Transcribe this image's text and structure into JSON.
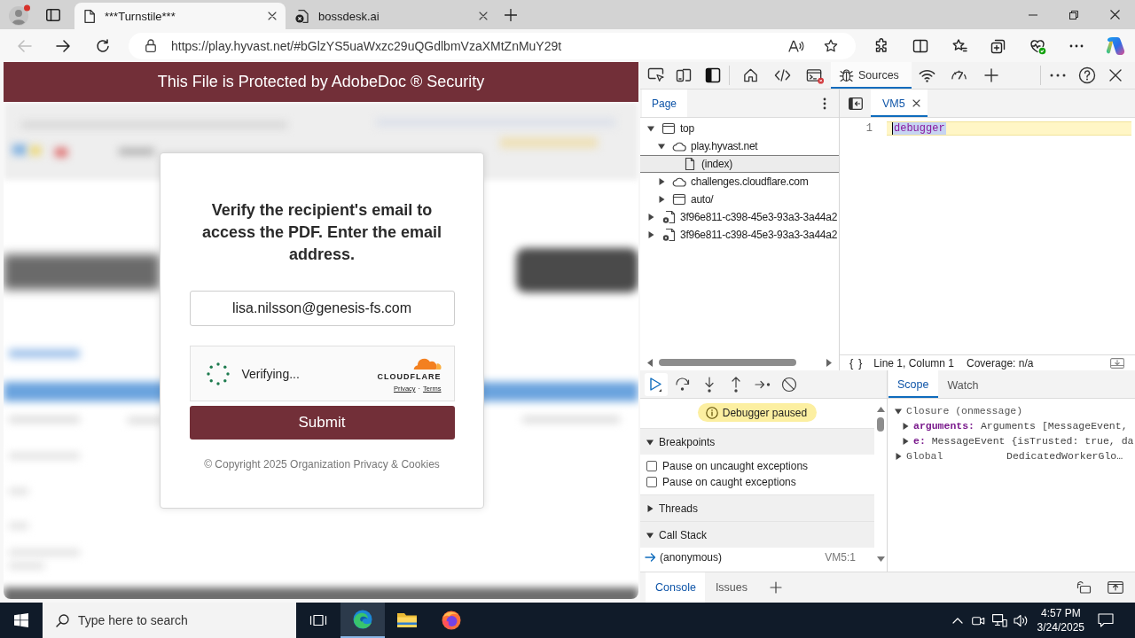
{
  "browser": {
    "tabs": [
      {
        "kind": "page",
        "title": "***Turnstile***",
        "selected": true
      },
      {
        "kind": "site",
        "title": "bossdesk.ai",
        "selected": false
      }
    ],
    "back_disabled": true,
    "url": "https://play.hyvast.net/#bGlzYS5uaWxzc29uQGdlbmVzaXMtZnMuY29t"
  },
  "page": {
    "banner": "This File is Protected by AdobeDoc ® Security",
    "dialog": {
      "heading": "Verify the recipient's email to access the PDF. Enter the email address.",
      "email_field": {
        "value": "lisa.nilsson@genesis-fs.com"
      },
      "captcha": {
        "status": "Verifying...",
        "brand": "CLOUDFLARE",
        "links": [
          "Privacy",
          "Terms"
        ],
        "link_separator": "·"
      },
      "submit_button": "Submit",
      "footer": "© Copyright 2025 Organization Privacy & Cookies"
    }
  },
  "devtools": {
    "panel_tabs": [
      {
        "kind": "welcome",
        "selected": false,
        "error_badge": false
      },
      {
        "kind": "elements",
        "selected": false,
        "error_badge": false
      },
      {
        "kind": "console",
        "selected": false,
        "error_badge": true
      },
      {
        "kind": "sources",
        "label": "Sources",
        "selected": true,
        "error_badge": false
      },
      {
        "kind": "network",
        "selected": false,
        "error_badge": false
      },
      {
        "kind": "performance",
        "selected": false,
        "error_badge": false
      }
    ],
    "navigator": {
      "tabs": [
        {
          "label": "Page",
          "selected": true
        }
      ],
      "tree": [
        {
          "kind": "frame",
          "label": "top",
          "expanded": true,
          "selected": false,
          "children": [
            {
              "kind": "domain",
              "label": "play.hyvast.net",
              "expanded": true,
              "selected": false,
              "children": [
                {
                  "kind": "file",
                  "label": "(index)",
                  "selected": true
                }
              ]
            },
            {
              "kind": "domain",
              "label": "challenges.cloudflare.com",
              "expanded": false,
              "selected": false
            },
            {
              "kind": "frame",
              "label": "auto/",
              "expanded": false,
              "selected": false
            }
          ]
        },
        {
          "kind": "worker",
          "label": "3f96e811-c398-45e3-93a3-3a44a2",
          "expanded": false,
          "selected": false
        },
        {
          "kind": "worker",
          "label": "3f96e811-c398-45e3-93a3-3a44a2",
          "expanded": false,
          "selected": false
        }
      ]
    },
    "editor": {
      "tabs": [
        {
          "label": "VM5",
          "selected": true
        }
      ],
      "lines": [
        {
          "number": "1",
          "code": "debugger",
          "current": true,
          "selected": true
        }
      ],
      "status": {
        "pretty_print": "{ }",
        "position": "Line 1, Column 1",
        "coverage": "Coverage: n/a"
      }
    },
    "debugger": {
      "paused_message": "Debugger paused",
      "sections": [
        {
          "kind": "checkboxes",
          "title": "Breakpoints",
          "expanded": true,
          "items": [
            {
              "label": "Pause on uncaught exceptions",
              "checked": false
            },
            {
              "label": "Pause on caught exceptions",
              "checked": false
            }
          ]
        },
        {
          "title": "Threads",
          "expanded": false
        },
        {
          "kind": "frames",
          "title": "Call Stack",
          "expanded": true,
          "items": [
            {
              "name": "(anonymous)",
              "location": "VM5:1",
              "current": true
            }
          ]
        }
      ]
    },
    "scope": {
      "tabs": [
        {
          "label": "Scope",
          "selected": true
        },
        {
          "label": "Watch",
          "selected": false
        }
      ],
      "tree": [
        {
          "kind": "scope",
          "name": "Closure (onmessage)",
          "expanded": true,
          "children": [
            {
              "kind": "property",
              "name": "arguments:",
              "value": "Arguments [MessageEvent,",
              "expanded": false
            },
            {
              "kind": "property",
              "name": "e:",
              "value": "MessageEvent {isTrusted: true, da",
              "expanded": false
            }
          ]
        },
        {
          "kind": "scope",
          "name": "Global",
          "value": "DedicatedWorkerGlo…",
          "expanded": false
        }
      ]
    },
    "drawer": {
      "tabs": [
        {
          "label": "Console",
          "selected": true
        },
        {
          "label": "Issues",
          "selected": false
        }
      ]
    }
  },
  "taskbar": {
    "search": {
      "placeholder": "Type here to search"
    },
    "apps": [
      {
        "kind": "task_view",
        "active": false
      },
      {
        "kind": "edge",
        "active": true
      },
      {
        "kind": "file_explorer",
        "active": false
      },
      {
        "kind": "firefox",
        "active": false
      }
    ],
    "time": "4:57 PM",
    "date": "3/24/2025"
  }
}
